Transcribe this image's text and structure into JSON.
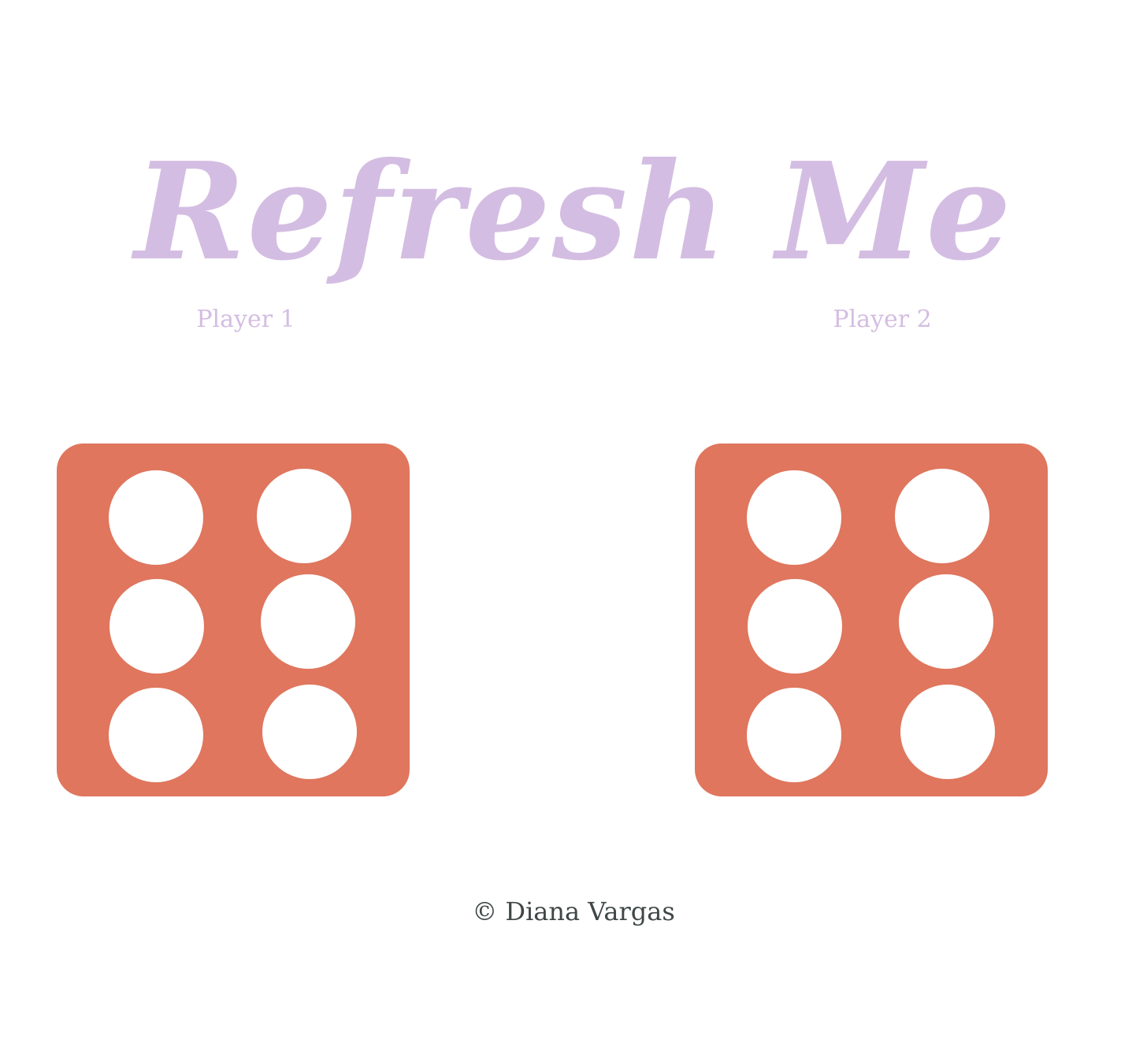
{
  "header": {
    "title": "Refresh Me"
  },
  "players": [
    {
      "label": "Player 1",
      "die_value": 6
    },
    {
      "label": "Player 2",
      "die_value": 6
    }
  ],
  "colors": {
    "title": "#d4bde2",
    "die_face": "#df765d",
    "pip": "#ffffff",
    "footer_text": "#3f4747"
  },
  "footer": {
    "text": "© Diana Vargas"
  }
}
